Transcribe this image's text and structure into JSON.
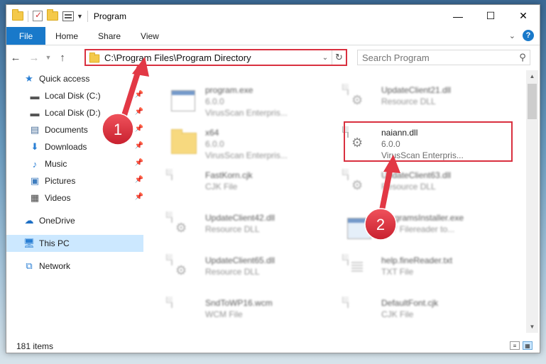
{
  "window": {
    "title": "Program",
    "controls": {
      "minimize": "—",
      "maximize": "☐",
      "close": "✕"
    }
  },
  "ribbon": {
    "tabs": [
      "File",
      "Home",
      "Share",
      "View"
    ]
  },
  "address": {
    "path": "C:\\Program Files\\Program Directory"
  },
  "search": {
    "placeholder": "Search Program"
  },
  "sidebar": {
    "quick_access": "Quick access",
    "items": [
      {
        "label": "Local Disk (C:)",
        "icon": "drive-icon"
      },
      {
        "label": "Local Disk (D:)",
        "icon": "drive-icon"
      },
      {
        "label": "Documents",
        "icon": "documents-icon"
      },
      {
        "label": "Downloads",
        "icon": "downloads-icon"
      },
      {
        "label": "Music",
        "icon": "music-icon"
      },
      {
        "label": "Pictures",
        "icon": "pictures-icon"
      },
      {
        "label": "Videos",
        "icon": "videos-icon"
      }
    ],
    "onedrive": "OneDrive",
    "this_pc": "This PC",
    "network": "Network"
  },
  "files": [
    {
      "name": "program.exe",
      "meta1": "6.0.0",
      "meta2": "VirusScan Enterpris...",
      "icon": "exe-icon"
    },
    {
      "name": "UpdateClient21.dll",
      "meta1": "Resource DLL",
      "icon": "dll-icon"
    },
    {
      "name": "x64",
      "meta1": "6.0.0",
      "meta2": "VirusScan Enterpris...",
      "icon": "folder-icon"
    },
    {
      "name": "naiann.dll",
      "meta1": "6.0.0",
      "meta2": "VirusScan Enterpris...",
      "icon": "dll-icon"
    },
    {
      "name": "FastKorn.cjk",
      "meta1": "CJK File",
      "icon": "file-icon"
    },
    {
      "name": "UpdateClient63.dll",
      "meta1": "Resource DLL",
      "icon": "dll-icon"
    },
    {
      "name": "UpdateClient42.dll",
      "meta1": "Resource DLL",
      "icon": "dll-icon"
    },
    {
      "name": "ProgramsInstaller.exe",
      "meta1": "FTY Filereader to...",
      "icon": "exe-icon"
    },
    {
      "name": "UpdateClient65.dll",
      "meta1": "Resource DLL",
      "icon": "dll-icon"
    },
    {
      "name": "help.fineReader.txt",
      "meta1": "TXT File",
      "icon": "txt-icon"
    },
    {
      "name": "SndToWP16.wcm",
      "meta1": "WCM File",
      "icon": "file-icon"
    },
    {
      "name": "DefaultFont.cjk",
      "meta1": "CJK File",
      "icon": "file-icon"
    }
  ],
  "status": {
    "items_count": "181 items"
  },
  "annotations": {
    "step1": "1",
    "step2": "2"
  },
  "colors": {
    "accent": "#1979ca",
    "highlight_red": "#d9303f",
    "selected_bg": "#cce8ff"
  }
}
